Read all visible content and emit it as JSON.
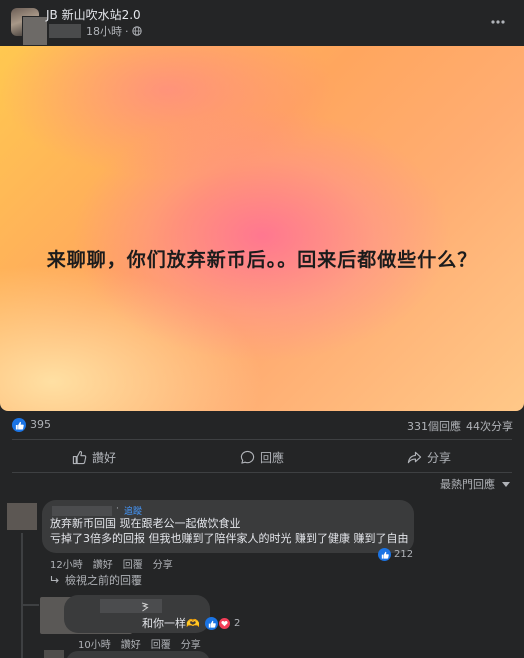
{
  "post": {
    "group_name": "JB 新山吹水站2.0",
    "time": "18小時",
    "banner_text": "来聊聊，你们放弃新币后。。回来后都做些什么？",
    "banner_colors": {
      "top_left": "#ffc850",
      "center": "#ff699b",
      "bottom_left": "#ffe6aa"
    }
  },
  "stats": {
    "likes": "395",
    "comments": "331個回應",
    "shares": "44次分享"
  },
  "actions": {
    "like_label": "讚好",
    "comment_label": "回應",
    "share_label": "分享"
  },
  "sort": {
    "label": "最熱門回應"
  },
  "comment1": {
    "tag": "追蹤",
    "line1": "放弃新币回国 现在跟老公一起做饮食业",
    "line2": "亏掉了3倍多的回报 但我也赚到了陪伴家人的时光 赚到了健康 赚到了自由",
    "reaction_count": "212",
    "time": "12小時",
    "like": "讚好",
    "reply": "回覆",
    "share": "分享"
  },
  "previous_replies": {
    "label": "檢視之前的回覆"
  },
  "comment2": {
    "text": "和你一样🫶",
    "reaction_count": "2",
    "time": "10小時",
    "like": "讚好",
    "reply": "回覆",
    "share": "分享"
  },
  "icons": {
    "privacy": "globe-icon",
    "more": "more-horizontal-icon",
    "like": "thumbs-up-icon",
    "comment": "speech-bubble-icon",
    "share": "share-arrow-icon",
    "sort": "caret-down-icon",
    "reply_arrow": "reply-arrow-icon"
  },
  "colors": {
    "background": "#242526",
    "bubble": "#3a3b3c",
    "accent": "#1b74e4",
    "love": "#f33e58",
    "text": "#e4e6eb",
    "muted": "#b0b3b8"
  }
}
